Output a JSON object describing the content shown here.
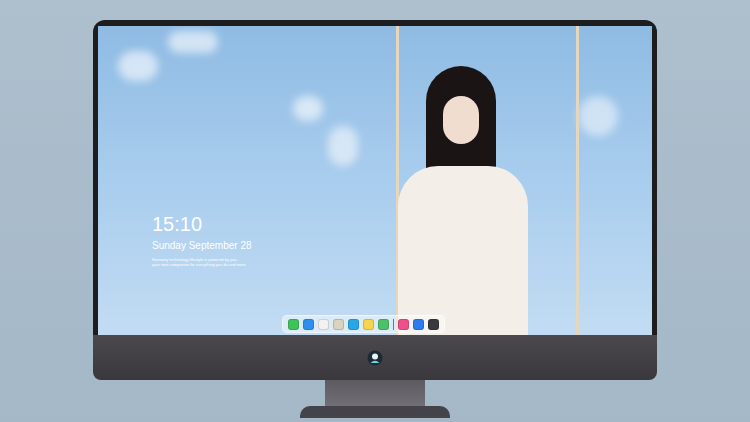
{
  "lock_screen": {
    "time": "15:10",
    "date": "Sunday September 28",
    "caption": [
      "Harmony technology lifestyle is powered by you,",
      "your next companion for everything you do and more"
    ]
  },
  "dock": {
    "groups": [
      [
        {
          "color": "#3ec25a"
        },
        {
          "color": "#2f8ff0"
        },
        {
          "color": "#f2f2f2"
        },
        {
          "color": "#d9d3c0"
        },
        {
          "color": "#2aa6e8"
        },
        {
          "color": "#f7d54a"
        },
        {
          "color": "#4cc06a"
        }
      ],
      [
        {
          "color": "#f0508a"
        },
        {
          "color": "#2f7cf0"
        },
        {
          "color": "#3a3a3e"
        }
      ]
    ]
  }
}
